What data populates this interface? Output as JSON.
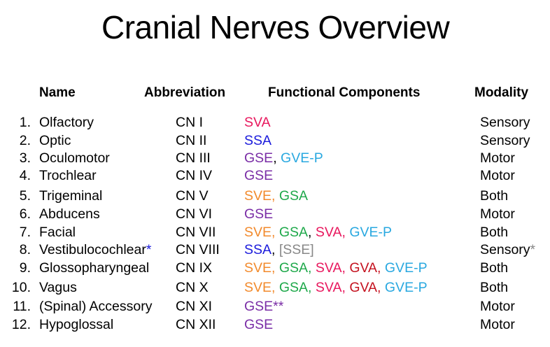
{
  "title": "Cranial Nerves Overview",
  "headers": {
    "name": "Name",
    "abbreviation": "Abbreviation",
    "components": "Functional Components",
    "modality": "Modality"
  },
  "colors": {
    "SVA": "#e8175d",
    "SSA": "#1a1adc",
    "GSE": "#7a2da6",
    "GVE-P": "#29a8e0",
    "SVE": "#f28a2c",
    "GSA": "#1ea84a",
    "GVA": "#c4121f",
    "SSE": "#888888"
  },
  "rows": [
    {
      "num": "1.",
      "name": "Olfactory",
      "abbr": "CN I",
      "components": [
        {
          "t": "SVA",
          "c": "SVA"
        }
      ],
      "modality": "Sensory"
    },
    {
      "num": "2.",
      "name": "Optic",
      "abbr": "CN II",
      "components": [
        {
          "t": "SSA",
          "c": "SSA"
        }
      ],
      "modality": "Sensory"
    },
    {
      "num": "3.",
      "name": "Oculomotor",
      "abbr": "CN III",
      "components": [
        {
          "t": "GSE",
          "c": "GSE"
        },
        {
          "t": ", ",
          "c": "sep"
        },
        {
          "t": "GVE-P",
          "c": "GVE-P"
        }
      ],
      "modality": "Motor"
    },
    {
      "num": "4.",
      "name": "Trochlear",
      "abbr": "CN IV",
      "components": [
        {
          "t": "GSE",
          "c": "GSE"
        }
      ],
      "modality": "Motor"
    },
    {
      "num": "5.",
      "name": "Trigeminal",
      "abbr": "CN V",
      "components": [
        {
          "t": "SVE, ",
          "c": "SVE"
        },
        {
          "t": "GSA",
          "c": "GSA"
        }
      ],
      "modality": "Both"
    },
    {
      "num": "6.",
      "name": "Abducens",
      "abbr": "CN VI",
      "components": [
        {
          "t": "GSE",
          "c": "GSE"
        }
      ],
      "modality": "Motor"
    },
    {
      "num": "7.",
      "name": "Facial",
      "abbr": "CN VII",
      "components": [
        {
          "t": "SVE, ",
          "c": "SVE"
        },
        {
          "t": "GSA",
          "c": "GSA"
        },
        {
          "t": ", ",
          "c": "sep"
        },
        {
          "t": "SVA, ",
          "c": "SVA"
        },
        {
          "t": "GVE-P",
          "c": "GVE-P"
        }
      ],
      "modality": "Both"
    },
    {
      "num": "8.",
      "name": "Vestibulocochlear",
      "name_star": "*",
      "abbr": "CN VIII",
      "components": [
        {
          "t": "SSA",
          "c": "SSA"
        },
        {
          "t": ", ",
          "c": "sep"
        },
        {
          "t": "[SSE]",
          "c": "SSE"
        }
      ],
      "modality": "Sensory",
      "mod_star": "*"
    },
    {
      "num": "9.",
      "name": "Glossopharyngeal",
      "abbr": "CN IX",
      "components": [
        {
          "t": "SVE, ",
          "c": "SVE"
        },
        {
          "t": "GSA, ",
          "c": "GSA"
        },
        {
          "t": "SVA, ",
          "c": "SVA"
        },
        {
          "t": "GVA, ",
          "c": "GVA"
        },
        {
          "t": "GVE-P",
          "c": "GVE-P"
        }
      ],
      "modality": "Both"
    },
    {
      "num": "10.",
      "name": "Vagus",
      "abbr": "CN X",
      "components": [
        {
          "t": "SVE, ",
          "c": "SVE"
        },
        {
          "t": "GSA, ",
          "c": "GSA"
        },
        {
          "t": "SVA, ",
          "c": "SVA"
        },
        {
          "t": "GVA, ",
          "c": "GVA"
        },
        {
          "t": "GVE-P",
          "c": "GVE-P"
        }
      ],
      "modality": "Both"
    },
    {
      "num": "11.",
      "name": "(Spinal) Accessory",
      "abbr": "CN XI",
      "components": [
        {
          "t": "GSE**",
          "c": "GSE"
        }
      ],
      "modality": "Motor"
    },
    {
      "num": "12.",
      "name": "Hypoglossal",
      "abbr": "CN XII",
      "components": [
        {
          "t": "GSE",
          "c": "GSE"
        }
      ],
      "modality": "Motor"
    }
  ]
}
